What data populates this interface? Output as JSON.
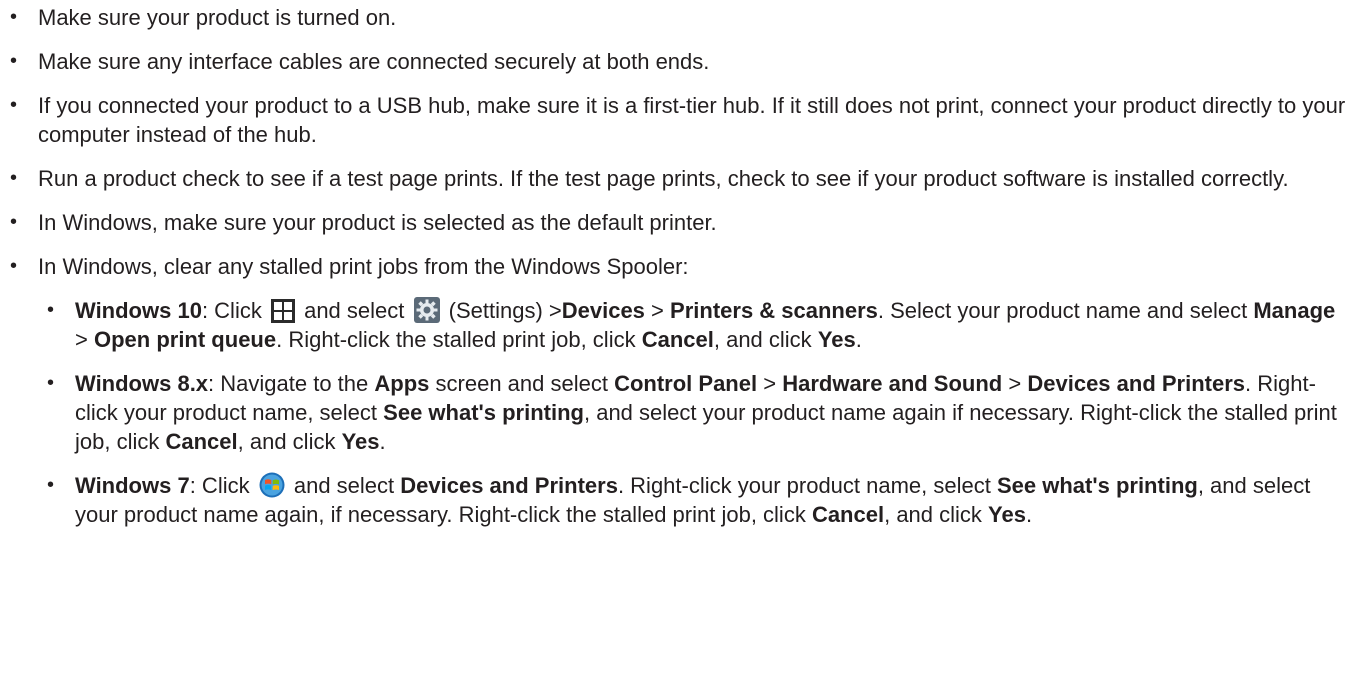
{
  "items": [
    {
      "text": "Make sure your product is turned on."
    },
    {
      "text": "Make sure any interface cables are connected securely at both ends."
    },
    {
      "text": "If you connected your product to a USB hub, make sure it is a first-tier hub. If it still does not print, connect your product directly to your computer instead of the hub."
    },
    {
      "text": "Run a product check to see if a test page prints. If the test page prints, check to see if your product software is installed correctly."
    },
    {
      "text": "In Windows, make sure your product is selected as the default printer."
    },
    {
      "text": "In Windows, clear any stalled print jobs from the Windows Spooler:"
    }
  ],
  "sub": {
    "win10": {
      "os": "Windows 10",
      "t1": ": Click",
      "t2": "and select",
      "t3": "(Settings) >",
      "devices": "Devices",
      "t4": ">",
      "printers_scanners": "Printers & scanners",
      "t5": ". Select your product name and select",
      "manage": "Manage",
      "t6": ">",
      "open_queue": "Open print queue",
      "t7": ". Right-click the stalled print job, click",
      "cancel": "Cancel",
      "t8": ", and click",
      "yes": "Yes",
      "t9": "."
    },
    "win8": {
      "os": "Windows 8.x",
      "t1": ": Navigate to the",
      "apps": "Apps",
      "t2": "screen and select",
      "control_panel": "Control Panel",
      "t3": ">",
      "hardware_sound": "Hardware and Sound",
      "t4": ">",
      "devices_printers": "Devices and Printers",
      "t5": ". Right-click your product name, select",
      "see_printing": "See what's printing",
      "t6": ", and select your product name again if necessary. Right-click the stalled print job, click",
      "cancel": "Cancel",
      "t7": ", and click",
      "yes": "Yes",
      "t8": "."
    },
    "win7": {
      "os": "Windows 7",
      "t1": ": Click",
      "t2": "and select",
      "devices_printers": "Devices and Printers",
      "t3": ". Right-click your product name, select",
      "see_printing": "See what's printing",
      "t4": ", and select your product name again, if necessary. Right-click the stalled print job, click",
      "cancel": "Cancel",
      "t5": ", and click",
      "yes": "Yes",
      "t6": "."
    }
  },
  "bullet_char": "•",
  "icons": {
    "start_win10": "windows-start-icon",
    "settings": "settings-gear-icon",
    "start_win7": "windows-7-orb-icon"
  }
}
